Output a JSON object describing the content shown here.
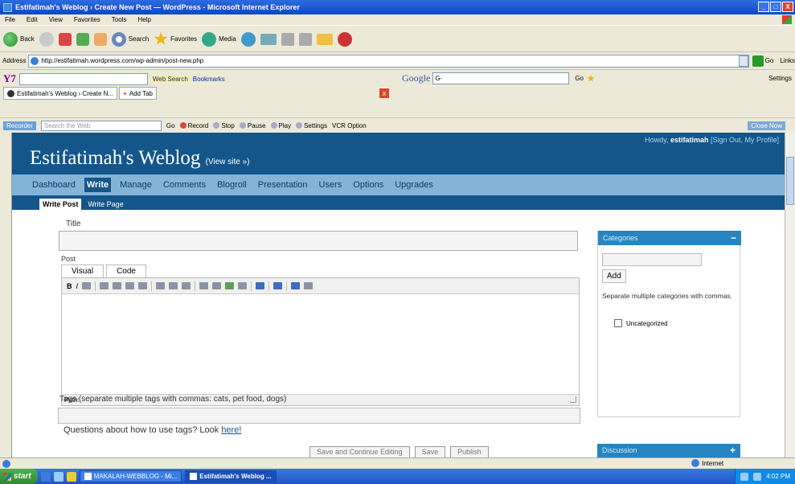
{
  "window": {
    "title": "Estifatimah's Weblog › Create New Post — WordPress - Microsoft Internet Explorer",
    "controls": [
      "_",
      "□",
      "X"
    ]
  },
  "menu": [
    "File",
    "Edit",
    "View",
    "Favorites",
    "Tools",
    "Help"
  ],
  "toolbar": {
    "back": "Back",
    "search": "Search",
    "favorites": "Favorites",
    "media": "Media"
  },
  "address": {
    "label": "Address",
    "url": "http://estifatimah.wordpress.com/wp-admin/post-new.php",
    "go": "Go",
    "links": "Links"
  },
  "yahoo": {
    "logo": "Y7",
    "web_search": "Web Search",
    "bookmarks": "Bookmarks"
  },
  "google": {
    "logo": "Google",
    "field": "G-",
    "go": "Go",
    "settings": "Settings"
  },
  "tabs": {
    "current": "Estifatimah's Weblog › Create N...",
    "add": "Add Tab"
  },
  "recorder": {
    "brand": "Recorder",
    "search_placeholder": "Search the Web",
    "go": "Go",
    "record": "Record",
    "stop": "Stop",
    "pause": "Pause",
    "play": "Play",
    "settings": "Settings",
    "vcr": "VCR Option",
    "close_now": "Close Now"
  },
  "wp": {
    "blog_title": "Estifatimah's Weblog",
    "view_site": "(View site »)",
    "howdy": "Howdy,",
    "username": "estifatimah",
    "user_links": "[Sign Out, My Profile]",
    "nav": [
      "Dashboard",
      "Write",
      "Manage",
      "Comments",
      "Blogroll",
      "Presentation",
      "Users",
      "Options",
      "Upgrades"
    ],
    "subnav": [
      "Write Post",
      "Write Page"
    ],
    "title_label": "Title",
    "post_label": "Post",
    "editor_tabs": [
      "Visual",
      "Code"
    ],
    "path_label": "Path:",
    "tags_label": "Tags (separate multiple tags with commas: cats, pet food, dogs)",
    "tags_help": "Questions about how to use tags? Look",
    "tags_help_link": "here!",
    "buttons": [
      "Save and Continue Editing",
      "Save",
      "Publish"
    ],
    "categories": {
      "header": "Categories",
      "toggle": "−",
      "add": "Add",
      "help": "Separate multiple categories with commas.",
      "items": [
        "Uncategorized"
      ]
    },
    "discussion": {
      "header": "Discussion",
      "toggle": "+"
    }
  },
  "status": {
    "zone": "Internet"
  },
  "taskbar": {
    "start": "start",
    "items": [
      "MAKALAH-WEBBLOG - Mi...",
      "Estifatimah's Weblog ..."
    ],
    "time": "4:02 PM"
  }
}
